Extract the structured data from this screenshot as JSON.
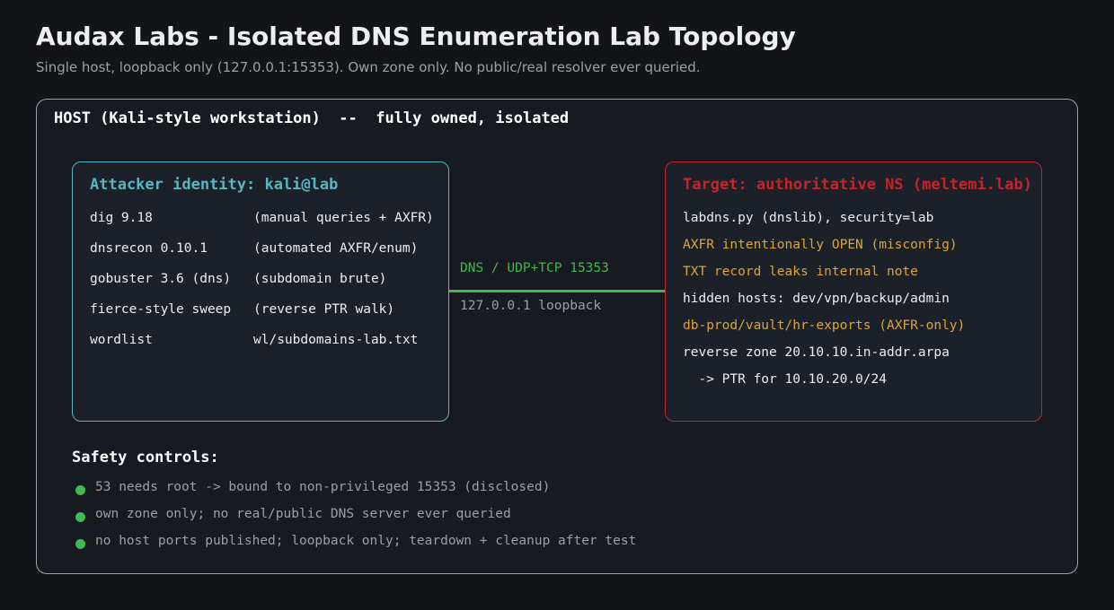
{
  "header": {
    "title": "Audax Labs - Isolated DNS Enumeration Lab Topology",
    "subtitle": "Single host, loopback only (127.0.0.1:15353). Own zone only. No public/real resolver ever queried."
  },
  "host": {
    "label": "HOST (Kali-style workstation)  --  fully owned, isolated"
  },
  "attacker": {
    "title": "Attacker identity: kali@lab",
    "tools": [
      {
        "name": "dig 9.18",
        "desc": "(manual queries + AXFR)"
      },
      {
        "name": "dnsrecon 0.10.1",
        "desc": "(automated AXFR/enum)"
      },
      {
        "name": "gobuster 3.6 (dns)",
        "desc": "(subdomain brute)"
      },
      {
        "name": "fierce-style sweep",
        "desc": "(reverse PTR walk)"
      },
      {
        "name": "wordlist",
        "desc": "wl/subdomains-lab.txt"
      }
    ],
    "border_color": "#56b6c2"
  },
  "connection": {
    "protocol": "DNS / UDP+TCP 15353",
    "transport": "127.0.0.1 loopback",
    "color": "#3fb950"
  },
  "target": {
    "title": "Target: authoritative NS (meltemi.lab)",
    "lines": [
      {
        "text": "labdns.py (dnslib), security=lab",
        "highlight": false
      },
      {
        "text": "AXFR intentionally OPEN (misconfig)",
        "highlight": true
      },
      {
        "text": "TXT record leaks internal note",
        "highlight": true
      },
      {
        "text": "hidden hosts: dev/vpn/backup/admin",
        "highlight": false
      },
      {
        "text": "db-prod/vault/hr-exports (AXFR-only)",
        "highlight": true
      },
      {
        "text": "reverse zone 20.10.10.in-addr.arpa",
        "highlight": false
      },
      {
        "text": "  -> PTR for 10.10.20.0/24",
        "highlight": false
      }
    ],
    "border_color": "#c0242c",
    "highlight_color": "#d9a63c"
  },
  "safety": {
    "title": "Safety controls:",
    "items": [
      "53 needs root -> bound to non-privileged 15353 (disclosed)",
      "own zone only; no real/public DNS server ever queried",
      "no host ports published; loopback only; teardown + cleanup after test"
    ],
    "bullet_color": "#3fb950"
  }
}
